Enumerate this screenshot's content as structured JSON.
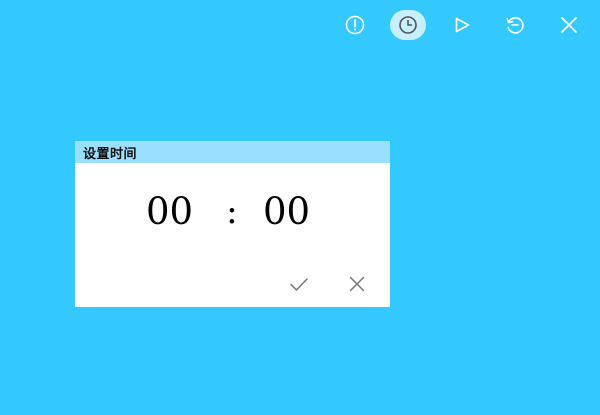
{
  "toolbar": {
    "buttons": [
      {
        "icon": "info-icon",
        "active": false
      },
      {
        "icon": "timer-icon",
        "active": true
      },
      {
        "icon": "play-icon",
        "active": false
      },
      {
        "icon": "reset-icon",
        "active": false
      },
      {
        "icon": "close-icon",
        "active": false
      }
    ]
  },
  "dialog": {
    "title": "设置时间",
    "hours": "00",
    "separator": ":",
    "minutes": "00",
    "confirm_icon": "checkmark-icon",
    "cancel_icon": "close-icon"
  },
  "colors": {
    "background": "#33c9ff",
    "dialog_header": "#99e0ff",
    "dialog_body": "#ffffff",
    "icon": "#ffffff",
    "active_icon": "#555555",
    "dialog_icon": "#777777"
  }
}
